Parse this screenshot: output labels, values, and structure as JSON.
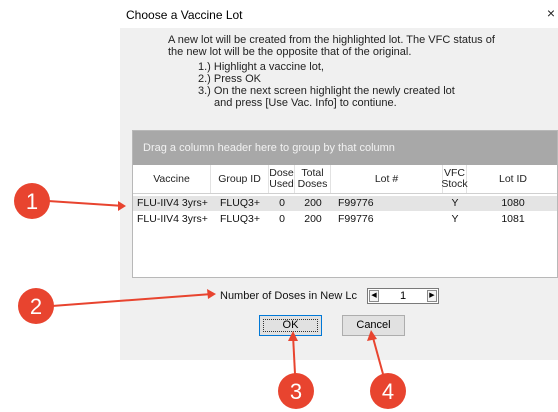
{
  "dialog": {
    "title": "Choose a Vaccine Lot",
    "close_glyph": "×",
    "instructions": {
      "line1": "A new lot will be created from the highlighted lot.  The VFC status of",
      "line2": "the new lot will be the opposite that of the original.",
      "step1": "1.) Highlight a vaccine lot,",
      "step2": "2.) Press OK",
      "step3": "3.) On the next screen highlight the newly created lot",
      "step4": "and press [Use Vac. Info] to  contiune."
    }
  },
  "grid": {
    "group_hint": "Drag a column header here to group by that column",
    "columns": {
      "vaccine": "Vaccine",
      "group_id": "Group ID",
      "dose_used": "Dose\nUsed",
      "total_doses": "Total\nDoses",
      "lot_number": "Lot #",
      "vfc_stock": "VFC\nStock",
      "lot_id": "Lot ID"
    },
    "rows": [
      {
        "vaccine": "FLU-IIV4 3yrs+",
        "group_id": "FLUQ3+",
        "dose_used": "0",
        "total_doses": "200",
        "lot_number": "F99776",
        "vfc_stock": "Y",
        "lot_id": "1080",
        "selected": true
      },
      {
        "vaccine": "FLU-IIV4 3yrs+",
        "group_id": "FLUQ3+",
        "dose_used": "0",
        "total_doses": "200",
        "lot_number": "F99776",
        "vfc_stock": "Y",
        "lot_id": "1081",
        "selected": false
      }
    ]
  },
  "doses": {
    "label": "Number of Doses in New Lc",
    "value": "1",
    "decrement_glyph": "◀",
    "increment_glyph": "▶"
  },
  "buttons": {
    "ok": "OK",
    "cancel": "Cancel"
  },
  "callouts": {
    "color": "#e8442f",
    "labels": [
      "1",
      "2",
      "3",
      "4"
    ]
  }
}
